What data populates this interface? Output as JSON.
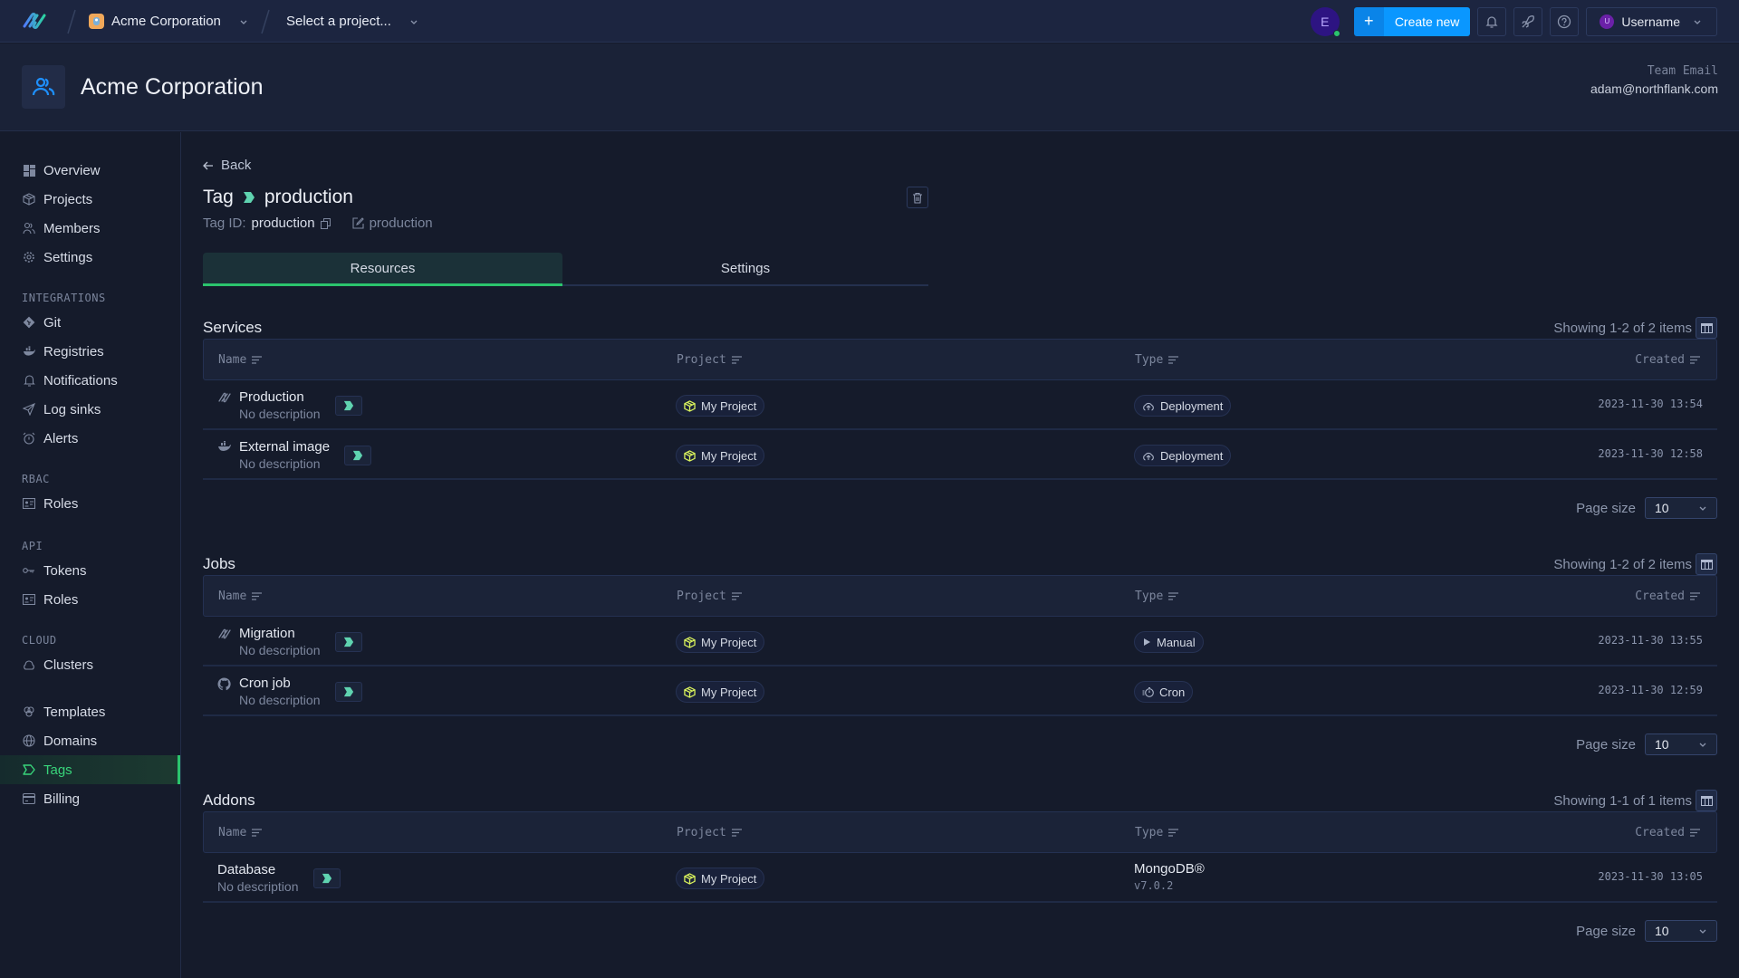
{
  "topbar": {
    "org_name": "Acme Corporation",
    "project_select": "Select a project...",
    "avatar_initial": "E",
    "create_label": "Create new",
    "user_initial": "U",
    "username": "Username"
  },
  "header": {
    "team_name": "Acme Corporation",
    "team_email_label": "Team Email",
    "team_email": "adam@northflank.com"
  },
  "sidebar": {
    "items": [
      {
        "label": "Overview",
        "icon": "grid-icon"
      },
      {
        "label": "Projects",
        "icon": "box-icon"
      },
      {
        "label": "Members",
        "icon": "users-icon"
      },
      {
        "label": "Settings",
        "icon": "gear-icon"
      }
    ],
    "integrations_title": "INTEGRATIONS",
    "integrations": [
      {
        "label": "Git",
        "icon": "git-icon"
      },
      {
        "label": "Registries",
        "icon": "docker-icon"
      },
      {
        "label": "Notifications",
        "icon": "bell-icon"
      },
      {
        "label": "Log sinks",
        "icon": "send-icon"
      },
      {
        "label": "Alerts",
        "icon": "alarm-icon"
      }
    ],
    "rbac_title": "RBAC",
    "rbac": [
      {
        "label": "Roles",
        "icon": "id-card-icon"
      }
    ],
    "api_title": "API",
    "api": [
      {
        "label": "Tokens",
        "icon": "key-icon"
      },
      {
        "label": "Roles",
        "icon": "id-card-icon"
      }
    ],
    "cloud_title": "CLOUD",
    "cloud": [
      {
        "label": "Clusters",
        "icon": "cloud-icon"
      }
    ],
    "other": [
      {
        "label": "Templates",
        "icon": "templates-icon"
      },
      {
        "label": "Domains",
        "icon": "globe-icon"
      },
      {
        "label": "Tags",
        "icon": "tag-icon",
        "active": true
      },
      {
        "label": "Billing",
        "icon": "credit-card-icon"
      }
    ]
  },
  "page": {
    "back_label": "Back",
    "title_prefix": "Tag",
    "tag_name": "production",
    "tag_id_label": "Tag ID:",
    "tag_id": "production",
    "tag_description": "production",
    "tabs": [
      {
        "label": "Resources",
        "active": true
      },
      {
        "label": "Settings",
        "active": false
      }
    ],
    "tag_color": "#5fd3b0"
  },
  "columns": {
    "name": "Name",
    "project": "Project",
    "type": "Type",
    "created": "Created"
  },
  "page_size_label": "Page size",
  "services": {
    "title": "Services",
    "showing": "Showing 1-2 of 2 items",
    "page_size": "10",
    "rows": [
      {
        "name": "Production",
        "description": "No description",
        "project": "My Project",
        "type": "Deployment",
        "created": "2023-11-30 13:54"
      },
      {
        "name": "External image",
        "description": "No description",
        "project": "My Project",
        "type": "Deployment",
        "created": "2023-11-30 12:58"
      }
    ]
  },
  "jobs": {
    "title": "Jobs",
    "showing": "Showing 1-2 of 2 items",
    "page_size": "10",
    "rows": [
      {
        "name": "Migration",
        "description": "No description",
        "project": "My Project",
        "type": "Manual",
        "created": "2023-11-30 13:55"
      },
      {
        "name": "Cron job",
        "description": "No description",
        "project": "My Project",
        "type": "Cron",
        "created": "2023-11-30 12:59"
      }
    ]
  },
  "addons": {
    "title": "Addons",
    "showing": "Showing 1-1 of 1 items",
    "page_size": "10",
    "rows": [
      {
        "name": "Database",
        "description": "No description",
        "project": "My Project",
        "type": "MongoDB®",
        "version": "v7.0.2",
        "created": "2023-11-30 13:05"
      }
    ]
  }
}
